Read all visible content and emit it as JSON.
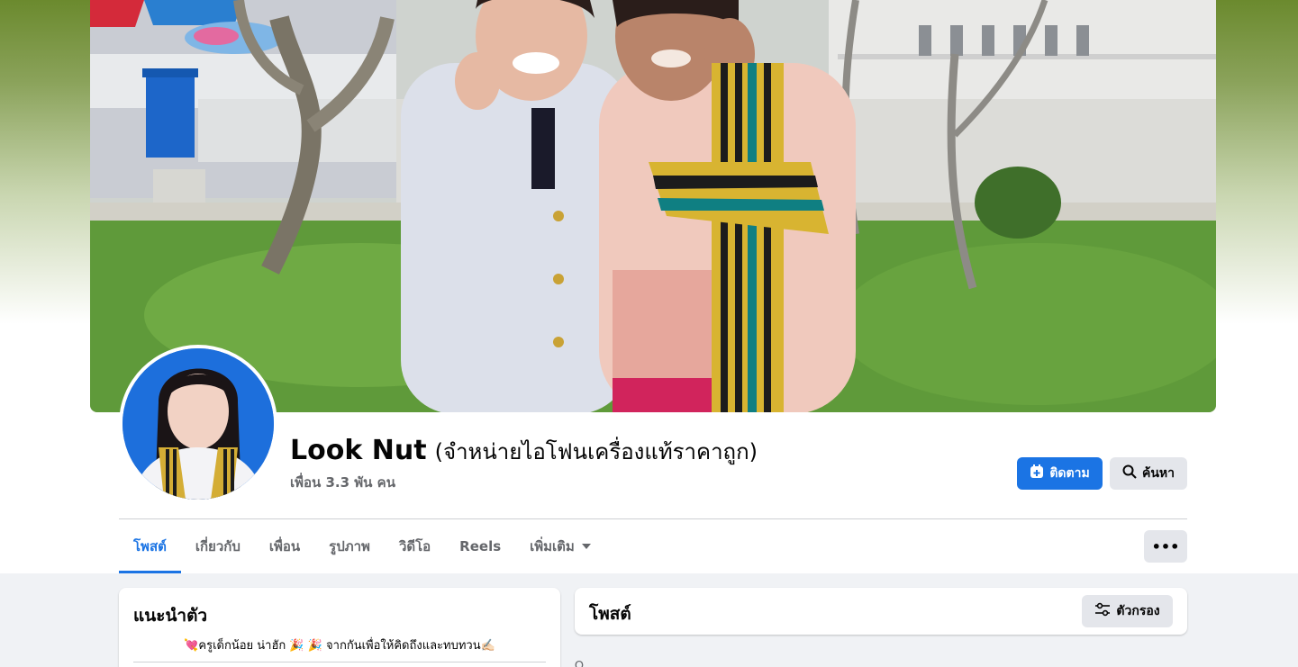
{
  "profile": {
    "name": "Look Nut",
    "name_suffix": "(จำหน่ายไอโฟนเครื่องแท้ราคาถูก)",
    "friends": "เพื่อน 3.3 พัน คน"
  },
  "actions": {
    "follow_label": "ติดตาม",
    "follow_icon": "add-friend-icon",
    "search_label": "ค้นหา",
    "search_icon": "search-icon",
    "more_label": "•••"
  },
  "tabs": [
    {
      "label": "โพสต์",
      "active": true
    },
    {
      "label": "เกี่ยวกับ",
      "active": false
    },
    {
      "label": "เพื่อน",
      "active": false
    },
    {
      "label": "รูปภาพ",
      "active": false
    },
    {
      "label": "วิดีโอ",
      "active": false
    },
    {
      "label": "Reels",
      "active": false
    },
    {
      "label": "เพิ่มเติม",
      "active": false
    }
  ],
  "intro": {
    "title": "แนะนำตัว",
    "bio": "💘ครูเด็กน้อย น่าฮัก 🎉 🎉 จากกันเพื่อให้คิดถึงและทบทวน✍🏻"
  },
  "posts": {
    "title": "โพสต์",
    "filter_label": "ตัวกรอง",
    "filter_icon": "filter-icon",
    "peek_text": "Ω‥‥‥"
  },
  "colors": {
    "accent": "#1b74e4",
    "secondary_text": "#65676b",
    "button_gray": "#e4e6eb",
    "page_bg": "#f0f2f5"
  }
}
